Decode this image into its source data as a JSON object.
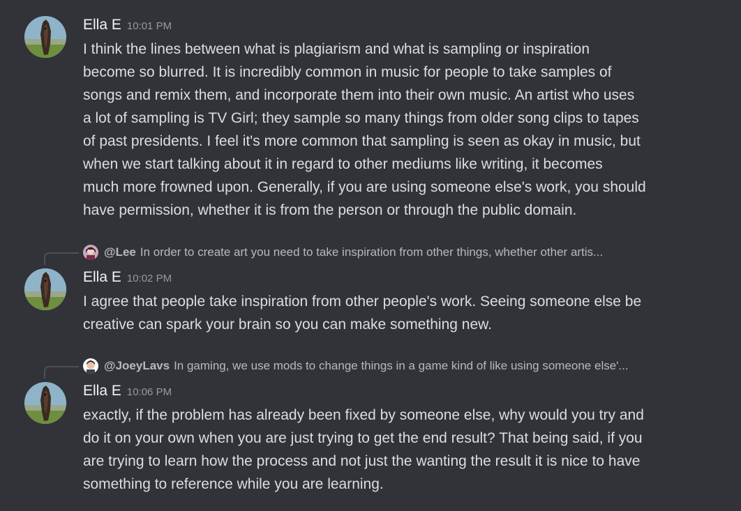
{
  "theme": {
    "background": "#313338",
    "text": "#dbdee1",
    "muted": "#949ba4",
    "author": "#f2f3f5"
  },
  "messages": [
    {
      "author": "Ella E",
      "time": "10:01 PM",
      "avatar_icon": "horse-avatar-icon",
      "lines": [
        "I think the lines between what is plagiarism and what is sampling or inspiration",
        "become so blurred. It is incredibly common in music for people to take samples of",
        "songs and remix them, and incorporate them into their own music. An artist who uses",
        "a lot of sampling is TV Girl; they sample so many things from older song clips to tapes",
        "of past presidents. I feel it's more common that sampling is seen as okay in music, but",
        "when we start talking about it in regard to other mediums like writing, it becomes",
        "much more frowned upon. Generally, if you are using someone else's work, you should",
        "have permission, whether it is from the person or through the public domain."
      ]
    },
    {
      "author": "Ella E",
      "time": "10:02 PM",
      "avatar_icon": "horse-avatar-icon",
      "reply": {
        "user": "@Lee",
        "snippet": "In order to create art you need to take inspiration from other things, whether other artis...",
        "avatar_icon": "lee-avatar-icon"
      },
      "lines": [
        "I agree that people take inspiration from other people's work. Seeing someone else be",
        "creative can spark your brain so you can make something new."
      ]
    },
    {
      "author": "Ella E",
      "time": "10:06 PM",
      "avatar_icon": "horse-avatar-icon",
      "reply": {
        "user": "@JoeyLavs",
        "snippet": "In gaming, we use mods to change things in a game kind of like using someone else'...",
        "avatar_icon": "joeylavs-avatar-icon"
      },
      "lines": [
        "exactly, if the problem has already been fixed by someone else, why would you try and",
        "do it on your own when you are just trying to get the end result? That  being said, if you",
        "are trying to learn how the process and not just the wanting the result it is nice to have",
        "something to reference while you are learning."
      ]
    }
  ]
}
